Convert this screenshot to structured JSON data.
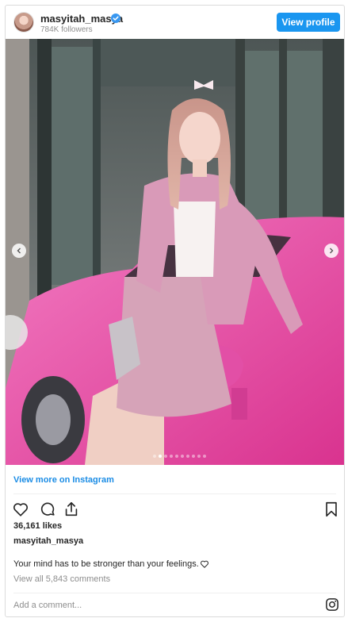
{
  "header": {
    "username": "masyitah_masya",
    "followers": "784K followers",
    "view_profile_label": "View profile"
  },
  "carousel": {
    "slide_count": 10,
    "active_slide": 2
  },
  "view_more_label": "View more on Instagram",
  "likes": "36,161 likes",
  "author": "masyitah_masya",
  "caption": "Your mind has to be stronger than your feelings.",
  "comments_label": "View all 5,843 comments",
  "add_comment_placeholder": "Add a comment...",
  "icons": [
    "verified-icon",
    "heart-icon",
    "comment-icon",
    "share-icon",
    "bookmark-icon",
    "instagram-icon",
    "chevron-left-icon",
    "chevron-right-icon"
  ],
  "colors": {
    "accent": "#1a96f0",
    "link": "#1a8ce5",
    "muted": "#8e8e8e"
  }
}
